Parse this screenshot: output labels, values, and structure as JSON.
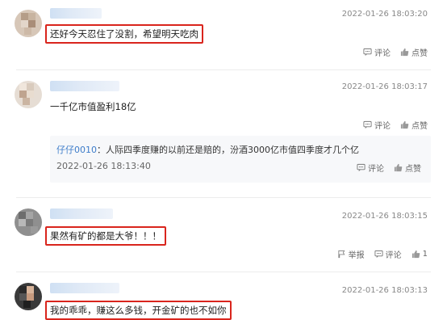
{
  "comments": [
    {
      "time": "2022-01-26 18:03:20",
      "text": "还好今天忍住了没割，希望明天吃肉",
      "actions": {
        "comment": "评论",
        "like": "点赞"
      }
    },
    {
      "time": "2022-01-26 18:03:17",
      "text": "一千亿市值盈利18亿",
      "actions": {
        "comment": "评论",
        "like": "点赞"
      },
      "reply": {
        "user": "仔仔0010",
        "text": "：人际四季度赚的以前还是赔的，汾酒3000亿市值四季度才几个亿",
        "time": "2022-01-26 18:13:40",
        "actions": {
          "comment": "评论",
          "like": "点赞"
        }
      }
    },
    {
      "time": "2022-01-26 18:03:15",
      "text": "果然有矿的都是大爷！！！",
      "actions": {
        "report": "举报",
        "comment": "评论",
        "like_count": "1"
      }
    },
    {
      "time": "2022-01-26 18:03:13",
      "text": "我的乖乖，赚这么多钱，开金矿的也不如你"
    }
  ],
  "icons": {
    "comment": "comment-icon",
    "like": "thumbs-up-icon",
    "report": "report-icon"
  },
  "colors": {
    "highlight_box": "#d9251d",
    "reply_user": "#3d7cc9",
    "timestamp": "#888888"
  }
}
